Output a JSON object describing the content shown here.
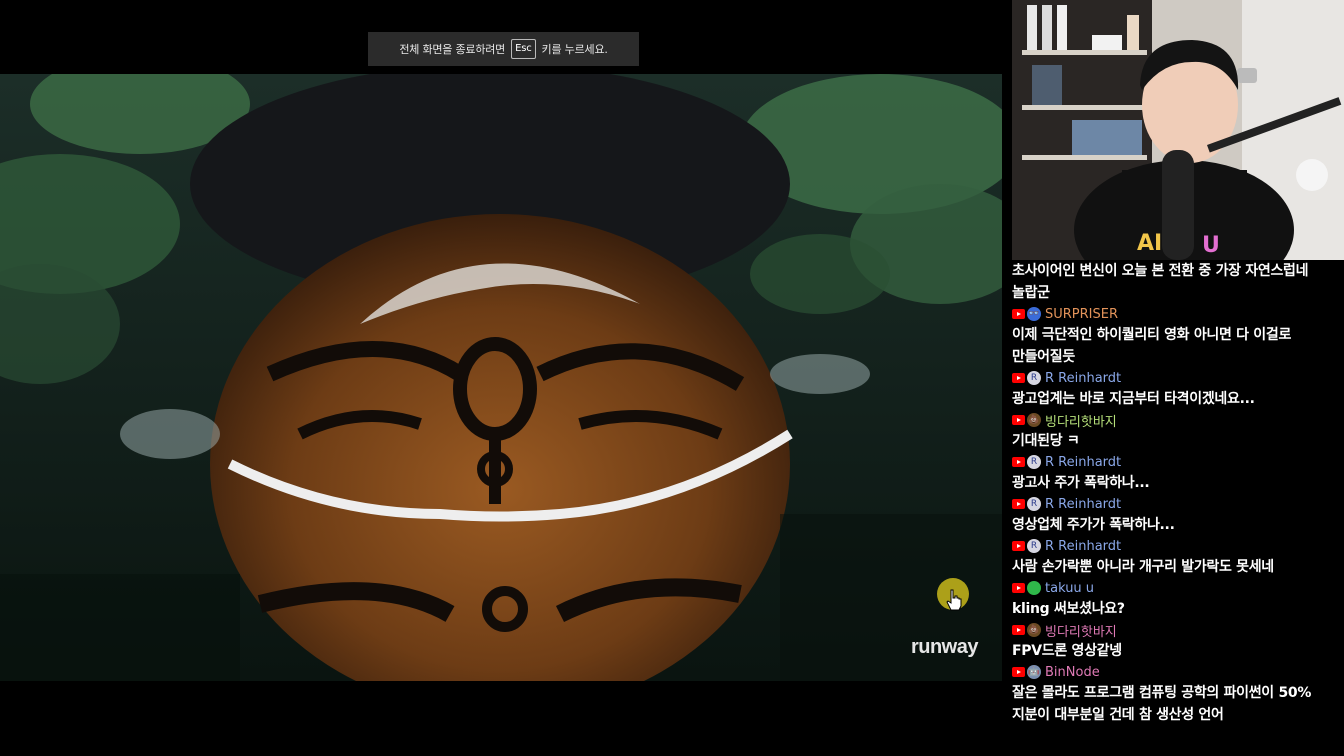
{
  "fullscreen_notice": {
    "before": "전체 화면을 종료하려면",
    "key": "Esc",
    "after": "키를 누르세요."
  },
  "video": {
    "watermark": "runway"
  },
  "chat": {
    "messages": [
      {
        "author": "",
        "text": "초사이어인 변신이 오늘 본 전환 중 가장 자연스럽네 놀랍군"
      },
      {
        "author": "SURPRISER",
        "author_color": "#e2935a",
        "avatar": "👓",
        "avatar_bg": "#3a6bd8",
        "text": "이제 극단적인 하이퀄리티 영화 아니면 다 이걸로 만들어질듯"
      },
      {
        "author": "R Reinhardt",
        "author_color": "#8aa7e8",
        "avatar": "R",
        "avatar_bg": "#d7d7e2",
        "text": "광고업계는 바로 지금부터 타격이겠네요..."
      },
      {
        "author": "빙다리핫바지",
        "author_color": "#b6e07a",
        "avatar": "💩",
        "avatar_bg": "#6b4a23",
        "text": "기대된당 ㅋ"
      },
      {
        "author": "R Reinhardt",
        "author_color": "#8aa7e8",
        "avatar": "R",
        "avatar_bg": "#d7d7e2",
        "text": "광고사 주가 폭락하나..."
      },
      {
        "author": "R Reinhardt",
        "author_color": "#8aa7e8",
        "avatar": "R",
        "avatar_bg": "#d7d7e2",
        "text": "영상업체 주가가 폭락하나..."
      },
      {
        "author": "R Reinhardt",
        "author_color": "#8aa7e8",
        "avatar": "R",
        "avatar_bg": "#d7d7e2",
        "text": "사람 손가락뿐 아니라 개구리 발가락도 못세네"
      },
      {
        "author": "takuu u",
        "author_color": "#8aa7e8",
        "avatar": "",
        "avatar_bg": "#2fb84a",
        "text": "kling 써보셨나요?"
      },
      {
        "author": "빙다리핫바지",
        "author_color": "#e07ab6",
        "avatar": "💩",
        "avatar_bg": "#6b4a23",
        "text": "FPV드론 영상같넹"
      },
      {
        "author": "BinNode",
        "author_color": "#e07ab6",
        "avatar": "🤖",
        "avatar_bg": "#7a8fb0",
        "text": "잘은 몰라도 프로그램 컴퓨팅 공학의 파이썬이 50% 지분이 대부분일 건데 참 생산성 언어"
      }
    ]
  }
}
